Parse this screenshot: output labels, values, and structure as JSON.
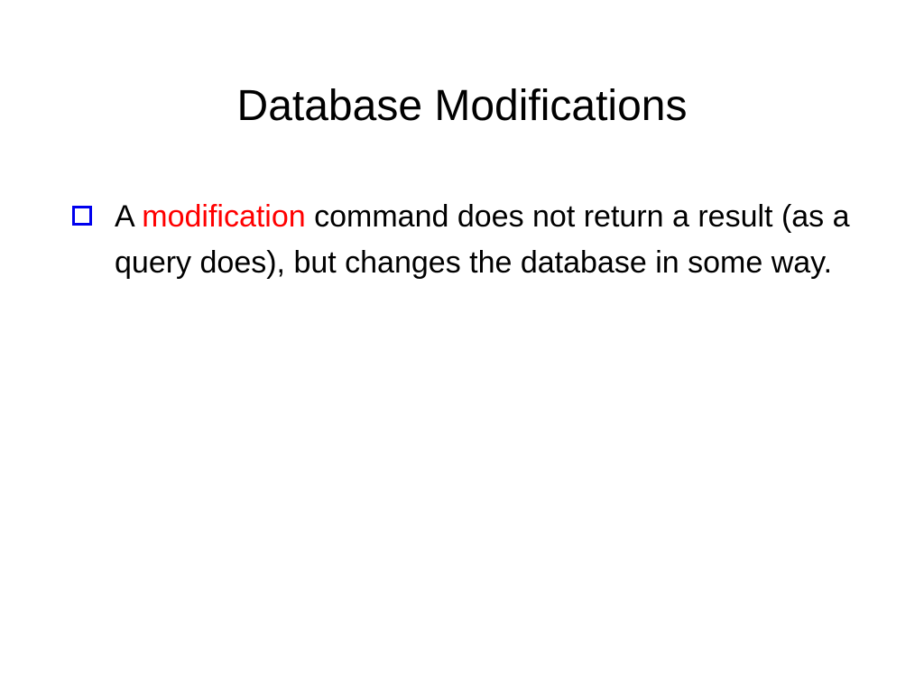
{
  "slide": {
    "title": "Database Modifications",
    "bullet": {
      "prefix": "A ",
      "highlighted": "modification",
      "suffix": " command does not return a result (as a query does), but changes the database in some way."
    }
  }
}
